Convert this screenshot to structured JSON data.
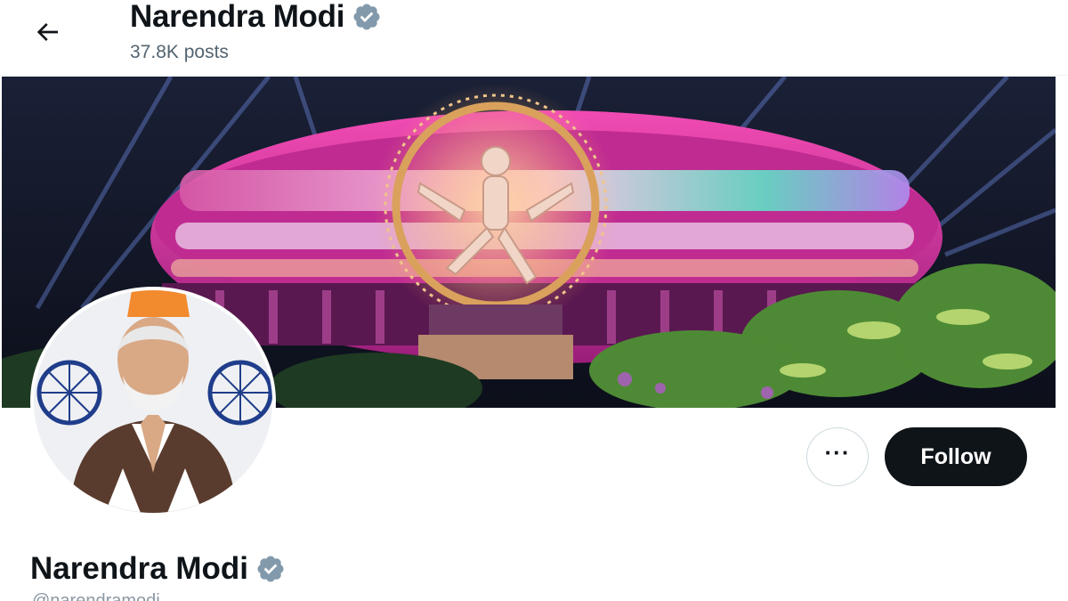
{
  "header": {
    "name": "Narendra Modi",
    "posts": "37.8K posts",
    "back_icon": "arrow-left-icon"
  },
  "profile": {
    "name": "Narendra Modi",
    "handle": "@narendramodi",
    "verified_icon": "verified-badge-icon",
    "verified_color": "#829aab"
  },
  "actions": {
    "more_label": "···",
    "follow_label": "Follow"
  },
  "colors": {
    "follow_bg": "#0f1419",
    "text_secondary": "#536471",
    "banner_magenta": "#e0359f"
  }
}
